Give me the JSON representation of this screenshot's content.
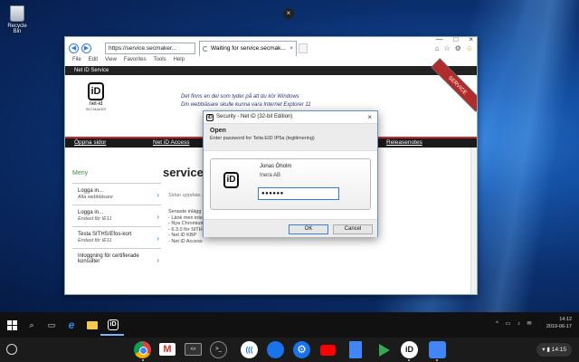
{
  "desktop": {
    "recycle_bin_label": "Recycle Bin",
    "top_close": "×"
  },
  "browser": {
    "address": "https://service.secmaker...",
    "tab_title": "Waiting for service.secmak...",
    "tab_close": "×",
    "menu": [
      "File",
      "Edit",
      "View",
      "Favorites",
      "Tools",
      "Help"
    ],
    "window_controls": [
      "—",
      "□",
      "×"
    ]
  },
  "page": {
    "header": "Net iD Service",
    "ribbon": "SERVICE",
    "logo_text": "net-id",
    "logo_sub": "SECMAKER",
    "notice_line1": "Det finns en del som tyder på att du kör Windows",
    "notice_line2": "Din webbläsare skulle kunna vara Internet Explorer 11",
    "bar_items": [
      "Öppna sidor",
      "Net iD Access",
      "Releasenotes"
    ],
    "menu_title": "Meny",
    "nav_items": [
      {
        "title": "Logga in...",
        "sub": "Alla webbläsare"
      },
      {
        "title": "Logga in...",
        "sub": "Endast för IE11"
      },
      {
        "title": "Testa SITHS/Efos-kort",
        "sub": "Endast för IE11"
      },
      {
        "title": "Inloggning för certifierade konsulter",
        "sub": ""
      }
    ],
    "main_title": "service.s",
    "updated": "Sidan uppdate...",
    "list_lines": [
      "Senaste inlägg",
      "- Länk men inte",
      "- Nya Chromium",
      "- 6.3.0 för SITH",
      "- Net iD KBP",
      "- Net iD Access"
    ]
  },
  "dialog": {
    "title": "Security - Net iD (32-bit Edition)",
    "heading": "Open",
    "subheading": "Enter password for Telia EID IP5a (legitimering)",
    "card_name": "Jonas Öholm",
    "card_org": "Inera AB",
    "password_mask": "●●●●●●",
    "ok_label": "OK",
    "cancel_label": "Cancel"
  },
  "taskbar": {
    "time": "14:12",
    "date": "2019-06-17"
  },
  "shelf": {
    "status": "14:15"
  }
}
